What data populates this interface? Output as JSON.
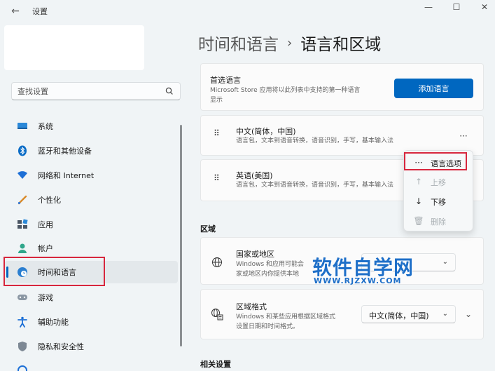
{
  "window": {
    "app_title": "设置",
    "back_glyph": "←",
    "minimize_glyph": "—",
    "maximize_glyph": "☐",
    "close_glyph": "✕"
  },
  "sidebar": {
    "search_placeholder": "查找设置",
    "items": [
      {
        "label": "系统",
        "icon": "monitor-icon"
      },
      {
        "label": "蓝牙和其他设备",
        "icon": "bluetooth-icon"
      },
      {
        "label": "网络和 Internet",
        "icon": "wifi-icon"
      },
      {
        "label": "个性化",
        "icon": "brush-icon"
      },
      {
        "label": "应用",
        "icon": "apps-icon"
      },
      {
        "label": "帐户",
        "icon": "person-icon"
      },
      {
        "label": "时间和语言",
        "icon": "globe-clock-icon",
        "active": true
      },
      {
        "label": "游戏",
        "icon": "gamepad-icon"
      },
      {
        "label": "辅助功能",
        "icon": "accessibility-icon"
      },
      {
        "label": "隐私和安全性",
        "icon": "shield-icon"
      }
    ]
  },
  "header": {
    "parent": "时间和语言",
    "separator": "›",
    "current": "语言和区域"
  },
  "preferred_languages": {
    "title": "首选语言",
    "desc_line1": "Microsoft Store 应用将以此列表中支持的第一种语言",
    "desc_line2": "显示",
    "add_button": "添加语言"
  },
  "languages": [
    {
      "name": "中文(简体，中国)",
      "desc": "语言包，文本到语音转换，语音识别，手写，基本输入法",
      "more": "···",
      "grip": "⠿"
    },
    {
      "name": "英语(美国)",
      "desc": "语言包，文本到语音转换，语音识别，手写，基本输入法",
      "grip": "⠿"
    }
  ],
  "context_menu": {
    "items": [
      {
        "label": "语言选项",
        "icon": "···",
        "disabled": false
      },
      {
        "label": "上移",
        "icon": "↑",
        "disabled": true
      },
      {
        "label": "下移",
        "icon": "↓",
        "disabled": false
      },
      {
        "label": "删除",
        "icon": "🗑",
        "disabled": true
      }
    ]
  },
  "region": {
    "heading": "区域",
    "country": {
      "title": "国家或地区",
      "desc_line1": "Windows 和应用可能会",
      "desc_line2": "家或地区内你提供本地",
      "icon": "globe-icon",
      "chevron": "⌄"
    },
    "format": {
      "title": "区域格式",
      "desc_line1": "Windows 和某些应用根据区域格式",
      "desc_line2": "设置日期和时间格式。",
      "value": "中文(简体，中国)",
      "icon": "region-format-icon",
      "chevron": "⌄",
      "expand": "⌄"
    }
  },
  "related": {
    "heading": "相关设置"
  },
  "watermark": {
    "main": "软件自学网",
    "sub": "WWW.RJZXW.COM"
  },
  "colors": {
    "accent": "#0067c0",
    "highlight_outline": "#d7263d",
    "watermark": "#1e6fc8"
  }
}
